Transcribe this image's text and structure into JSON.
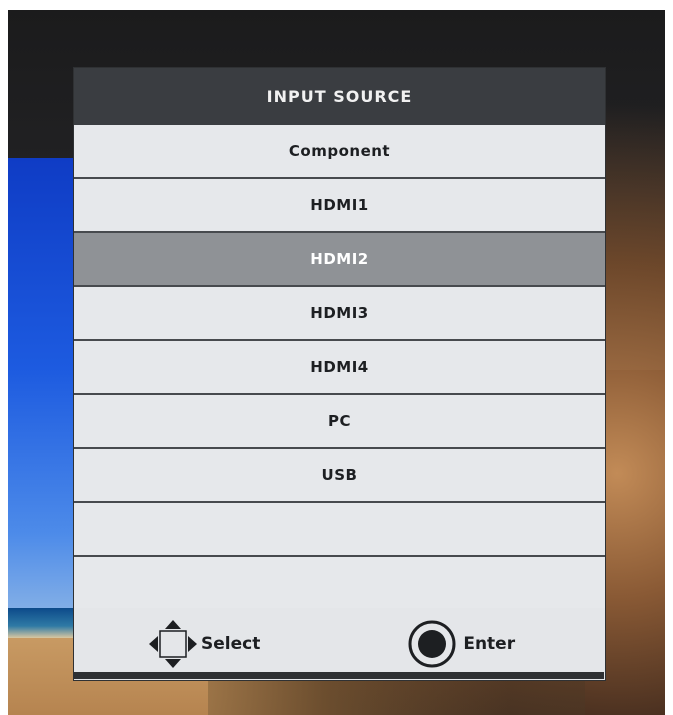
{
  "osd": {
    "title": "INPUT SOURCE",
    "items": [
      {
        "label": "Component",
        "selected": false
      },
      {
        "label": "HDMI1",
        "selected": false
      },
      {
        "label": "HDMI2",
        "selected": true
      },
      {
        "label": "HDMI3",
        "selected": false
      },
      {
        "label": "HDMI4",
        "selected": false
      },
      {
        "label": "PC",
        "selected": false
      },
      {
        "label": "USB",
        "selected": false
      },
      {
        "label": "",
        "selected": false
      },
      {
        "label": "",
        "selected": false
      }
    ],
    "footer": {
      "select_label": "Select",
      "select_icon": "dpad-icon",
      "enter_label": "Enter",
      "enter_icon": "enter-button-icon"
    }
  },
  "colors": {
    "header_bg": "#3a3d41",
    "row_bg": "#e6e8eb",
    "selected_bg": "#8f9296",
    "divider": "#474a4e"
  }
}
